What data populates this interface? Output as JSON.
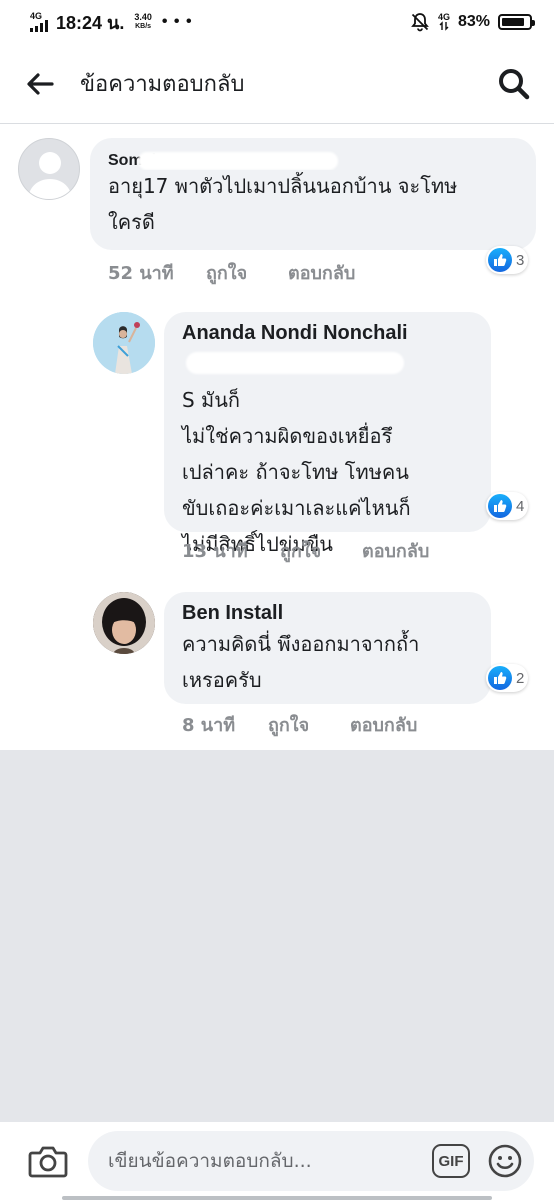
{
  "status_bar": {
    "network_top": "4G",
    "time": "18:24 น.",
    "speed_value": "3.40",
    "speed_unit": "KB/s",
    "dots": "• • •",
    "net_right": "4G",
    "battery_text": "83%",
    "battery_level": 0.83
  },
  "header": {
    "title": "ข้อความตอบกลับ",
    "back_icon": "arrow-left-icon",
    "search_icon": "search-icon"
  },
  "comments": [
    {
      "author": "Somai",
      "text": "อายุ17 พาตัวไปเมาปลิ้นนอกบ้าน จะโทษ\nใครดี",
      "time": "52 นาที",
      "like_label": "ถูกใจ",
      "reply_label": "ตอบกลับ",
      "reactions": "3"
    },
    {
      "author": "Ananda Nondi Nonchali",
      "text": "S มันก็\nไม่ใช่ความผิดของเหยื่อรึ\nเปล่าคะ ถ้าจะโทษ โทษคน\nขับเถอะค่ะเมาเละแค่ไหนก็\nไม่มีสิทธิ์ไปข่มขืน",
      "time": "13 นาที",
      "like_label": "ถูกใจ",
      "reply_label": "ตอบกลับ",
      "reactions": "4"
    },
    {
      "author": "Ben Install",
      "text": "ความคิดนี่ พึงออกมาจากถ้ำ\nเหรอครับ",
      "time": "8 นาที",
      "like_label": "ถูกใจ",
      "reply_label": "ตอบกลับ",
      "reactions": "2"
    }
  ],
  "composer": {
    "placeholder": "เขียนข้อความตอบกลับ...",
    "gif_label": "GIF",
    "camera_icon": "camera-icon",
    "emoji_icon": "smiley-icon"
  },
  "colors": {
    "like_blue": "#1877f2",
    "bubble_bg": "#f0f2f5",
    "empty_bg": "#e4e6ea",
    "meta_gray": "#8a8d91"
  }
}
